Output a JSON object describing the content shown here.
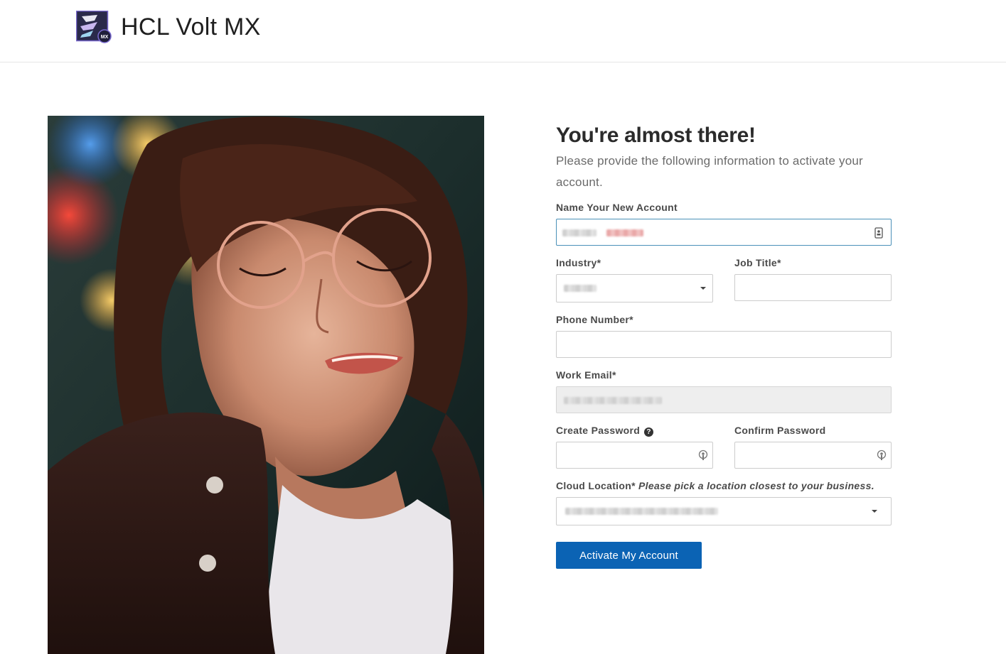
{
  "header": {
    "brand_name": "HCL Volt MX",
    "logo_badge": "MX"
  },
  "form": {
    "title": "You're almost there!",
    "subtitle": "Please provide the following information to activate your account.",
    "account_name": {
      "label": "Name Your New Account",
      "value_obscured": true,
      "icon": "contact-card-icon"
    },
    "industry": {
      "label": "Industry*",
      "value_obscured": true,
      "icon": "chevron-down-icon"
    },
    "job_title": {
      "label": "Job Title*",
      "value": ""
    },
    "phone_number": {
      "label": "Phone Number*",
      "value": ""
    },
    "work_email": {
      "label": "Work Email*",
      "value_obscured": true,
      "disabled": true
    },
    "create_password": {
      "label": "Create Password",
      "help_glyph": "?",
      "icon": "password-key-icon"
    },
    "confirm_password": {
      "label": "Confirm Password",
      "icon": "password-key-icon"
    },
    "cloud_location": {
      "label": "Cloud Location*",
      "hint": "Please pick a location closest to your business.",
      "value_obscured": true,
      "icon": "chevron-down-icon"
    },
    "submit_label": "Activate My Account"
  },
  "colors": {
    "primary_button": "#0b63b4",
    "focus_border": "#4a90b8",
    "disabled_field": "#eeeeee"
  }
}
